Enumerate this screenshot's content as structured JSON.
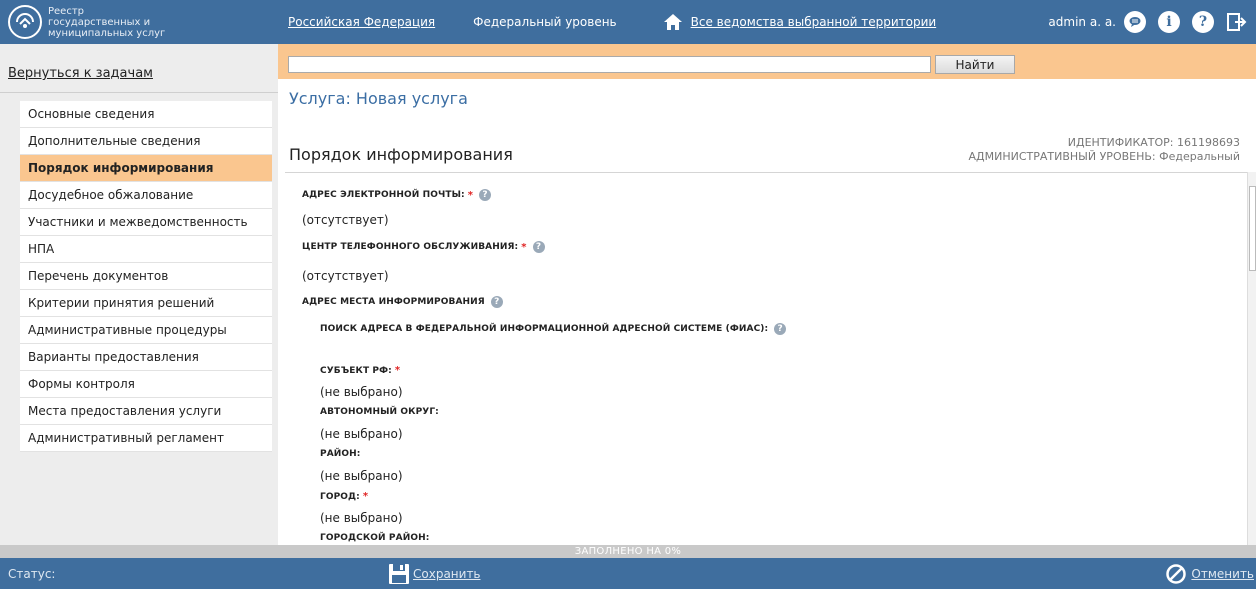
{
  "app": {
    "brand_text": "Реестр государственных и муниципальных услуг",
    "user": "admin a. a."
  },
  "topnav": {
    "region": "Российская Федерация",
    "level": "Федеральный уровень",
    "agencies": "Все ведомства выбранной территории"
  },
  "sidebar": {
    "back_link": "Вернуться к задачам",
    "items": [
      {
        "label": "Основные сведения"
      },
      {
        "label": "Дополнительные сведения"
      },
      {
        "label": "Порядок информирования"
      },
      {
        "label": "Досудебное обжалование"
      },
      {
        "label": "Участники и межведомственность"
      },
      {
        "label": "НПА"
      },
      {
        "label": "Перечень документов"
      },
      {
        "label": "Критерии принятия решений"
      },
      {
        "label": "Административные процедуры"
      },
      {
        "label": "Варианты предоставления"
      },
      {
        "label": "Формы контроля"
      },
      {
        "label": "Места предоставления услуги"
      },
      {
        "label": "Административный регламент"
      }
    ]
  },
  "search": {
    "value": "",
    "button": "Найти"
  },
  "main": {
    "service_title": "Услуга: Новая услуга",
    "section_title": "Порядок информирования",
    "identifier": "ИДЕНТИФИКАТОР: 161198693",
    "admin_level": "АДМИНИСТРАТИВНЫЙ УРОВЕНЬ: Федеральный",
    "fields": {
      "email_label": "АДРЕС ЭЛЕКТРОННОЙ ПОЧТЫ:",
      "email_value": "(отсутствует)",
      "phone_label": "ЦЕНТР ТЕЛЕФОННОГО ОБСЛУЖИВАНИЯ:",
      "phone_value": "(отсутствует)",
      "address_label": "АДРЕС МЕСТА ИНФОРМИРОВАНИЯ",
      "fias_label": "ПОИСК АДРЕСА В ФЕДЕРАЛЬНОЙ ИНФОРМАЦИОННОЙ АДРЕСНОЙ СИСТЕМЕ (ФИАС):",
      "subject_label": "СУБЪЕКТ РФ:",
      "subject_value": "(не выбрано)",
      "okrug_label": "АВТОНОМНЫЙ ОКРУГ:",
      "okrug_value": "(не выбрано)",
      "district_label": "РАЙОН:",
      "district_value": "(не выбрано)",
      "city_label": "ГОРОД:",
      "city_value": "(не выбрано)",
      "city_district_label": "ГОРОДСКОЙ РАЙОН:"
    },
    "required_mark": "*",
    "help_glyph": "?"
  },
  "progress": {
    "text": "ЗАПОЛНЕНО НА 0%",
    "percent": 0
  },
  "footer": {
    "status_label": "Статус:",
    "save": "Сохранить",
    "cancel": "Отменить"
  },
  "colors": {
    "header_blue": "#3f6e9e",
    "accent_orange": "#fac68f",
    "title_blue": "#3b6ea4",
    "required_red": "#e02424"
  },
  "icons": [
    "logo-icon",
    "home-icon",
    "chat-icon",
    "info-icon",
    "help-icon",
    "logout-icon",
    "save-icon",
    "cancel-icon"
  ]
}
